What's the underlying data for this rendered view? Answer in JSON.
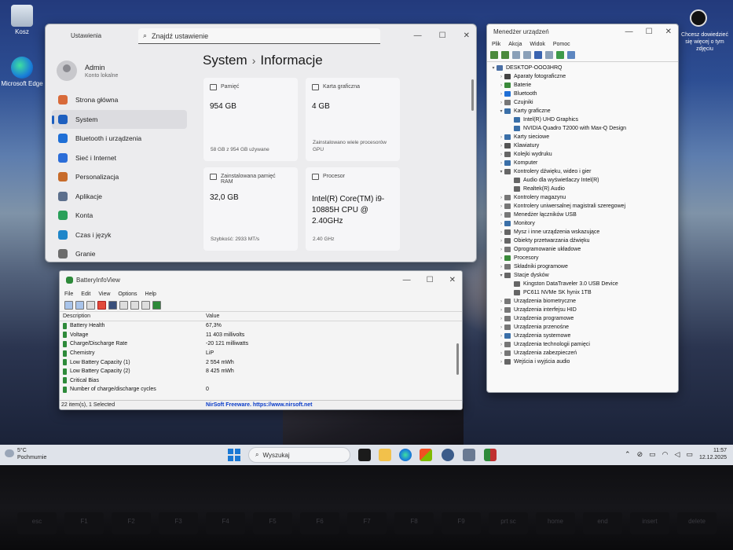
{
  "desktop": {
    "icons": [
      {
        "label": "Kosz",
        "icon": "recycle-bin-icon"
      },
      {
        "label": "Microsoft Edge",
        "icon": "edge-icon"
      }
    ],
    "spotlight_text": "Chcesz dowiedzieć się więcej o tym zdjęciu"
  },
  "settings": {
    "title": "Ustawienia",
    "search_placeholder": "Znajdź ustawienie",
    "user": {
      "name": "Admin",
      "sub": "Konto lokalne"
    },
    "nav": [
      {
        "label": "Strona główna",
        "color": "#d86a3a"
      },
      {
        "label": "System",
        "color": "#1d5fbf"
      },
      {
        "label": "Bluetooth i urządzenia",
        "color": "#1f6fd6"
      },
      {
        "label": "Sieć i Internet",
        "color": "#2b6dd8"
      },
      {
        "label": "Personalizacja",
        "color": "#c76b2a"
      },
      {
        "label": "Aplikacje",
        "color": "#5c6f8c"
      },
      {
        "label": "Konta",
        "color": "#2aa05a"
      },
      {
        "label": "Czas i język",
        "color": "#1f86c9"
      },
      {
        "label": "Granie",
        "color": "#6c6c6c"
      }
    ],
    "breadcrumb_parent": "System",
    "breadcrumb_sep": "›",
    "breadcrumb_current": "Informacje",
    "cards": [
      {
        "label": "Pamięć",
        "value": "954 GB",
        "sub": "58 GB z 954 GB używane"
      },
      {
        "label": "Karta graficzna",
        "value": "4 GB",
        "sub": "Zainstalowano wiele procesorów GPU"
      },
      {
        "label": "Zainstalowana pamięć RAM",
        "value": "32,0 GB",
        "sub": "Szybkość: 2933 MT/s"
      },
      {
        "label": "Procesor",
        "value": "Intel(R) Core(TM) i9-10885H CPU @ 2.40GHz",
        "sub": "2.40 GHz"
      }
    ]
  },
  "devmgr": {
    "title": "Menedżer urządzeń",
    "menu": [
      "Plik",
      "Akcja",
      "Widok",
      "Pomoc"
    ],
    "tree": [
      {
        "label": "DESKTOP-OOO3HRQ",
        "level": 0,
        "arrow": "▾",
        "color": "#4a6fa5"
      },
      {
        "label": "Aparaty fotograficzne",
        "level": 1,
        "arrow": "›",
        "color": "#444"
      },
      {
        "label": "Baterie",
        "level": 1,
        "arrow": "›",
        "color": "#3a8a3a"
      },
      {
        "label": "Bluetooth",
        "level": 1,
        "arrow": "›",
        "color": "#1f6fd6"
      },
      {
        "label": "Czujniki",
        "level": 1,
        "arrow": "›",
        "color": "#777"
      },
      {
        "label": "Karty graficzne",
        "level": 1,
        "arrow": "▾",
        "color": "#3a6fa8"
      },
      {
        "label": "Intel(R) UHD Graphics",
        "level": 2,
        "arrow": "",
        "color": "#3a6fa8"
      },
      {
        "label": "NVIDIA Quadro T2000 with Max-Q Design",
        "level": 2,
        "arrow": "",
        "color": "#3a6fa8"
      },
      {
        "label": "Karty sieciowe",
        "level": 1,
        "arrow": "›",
        "color": "#3a6fa8"
      },
      {
        "label": "Klawiatury",
        "level": 1,
        "arrow": "›",
        "color": "#555"
      },
      {
        "label": "Kolejki wydruku",
        "level": 1,
        "arrow": "›",
        "color": "#666"
      },
      {
        "label": "Komputer",
        "level": 1,
        "arrow": "›",
        "color": "#3a6fa8"
      },
      {
        "label": "Kontrolery dźwięku, wideo i gier",
        "level": 1,
        "arrow": "▾",
        "color": "#666"
      },
      {
        "label": "Audio dla wyświetlaczy Intel(R)",
        "level": 2,
        "arrow": "",
        "color": "#666"
      },
      {
        "label": "Realtek(R) Audio",
        "level": 2,
        "arrow": "",
        "color": "#666"
      },
      {
        "label": "Kontrolery magazynu",
        "level": 1,
        "arrow": "›",
        "color": "#777"
      },
      {
        "label": "Kontrolery uniwersalnej magistrali szeregowej",
        "level": 1,
        "arrow": "›",
        "color": "#777"
      },
      {
        "label": "Menedżer łączników USB",
        "level": 1,
        "arrow": "›",
        "color": "#777"
      },
      {
        "label": "Monitory",
        "level": 1,
        "arrow": "›",
        "color": "#3a6fa8"
      },
      {
        "label": "Mysz i inne urządzenia wskazujące",
        "level": 1,
        "arrow": "›",
        "color": "#666"
      },
      {
        "label": "Obiekty przetwarzania dźwięku",
        "level": 1,
        "arrow": "›",
        "color": "#666"
      },
      {
        "label": "Oprogramowanie układowe",
        "level": 1,
        "arrow": "›",
        "color": "#777"
      },
      {
        "label": "Procesory",
        "level": 1,
        "arrow": "›",
        "color": "#3a8a3a"
      },
      {
        "label": "Składniki programowe",
        "level": 1,
        "arrow": "›",
        "color": "#777"
      },
      {
        "label": "Stacje dysków",
        "level": 1,
        "arrow": "▾",
        "color": "#666"
      },
      {
        "label": "Kingston DataTraveler 3.0 USB Device",
        "level": 2,
        "arrow": "",
        "color": "#666"
      },
      {
        "label": "PC611 NVMe SK hynix 1TB",
        "level": 2,
        "arrow": "",
        "color": "#666"
      },
      {
        "label": "Urządzenia biometryczne",
        "level": 1,
        "arrow": "›",
        "color": "#777"
      },
      {
        "label": "Urządzenia interfejsu HID",
        "level": 1,
        "arrow": "›",
        "color": "#777"
      },
      {
        "label": "Urządzenia programowe",
        "level": 1,
        "arrow": "›",
        "color": "#777"
      },
      {
        "label": "Urządzenia przenośne",
        "level": 1,
        "arrow": "›",
        "color": "#777"
      },
      {
        "label": "Urządzenia systemowe",
        "level": 1,
        "arrow": "›",
        "color": "#3a6fa8"
      },
      {
        "label": "Urządzenia technologii pamięci",
        "level": 1,
        "arrow": "›",
        "color": "#777"
      },
      {
        "label": "Urządzenia zabezpieczeń",
        "level": 1,
        "arrow": "›",
        "color": "#777"
      },
      {
        "label": "Wejścia i wyjścia audio",
        "level": 1,
        "arrow": "›",
        "color": "#666"
      }
    ]
  },
  "battery": {
    "title": "BatteryInfoView",
    "menu": [
      "File",
      "Edit",
      "View",
      "Options",
      "Help"
    ],
    "col_desc": "Description",
    "col_val": "Value",
    "rows": [
      {
        "desc": "Battery Health",
        "val": "67,3%"
      },
      {
        "desc": "Voltage",
        "val": "11 403 millivolts"
      },
      {
        "desc": "Charge/Discharge Rate",
        "val": "-20 121 milliwatts"
      },
      {
        "desc": "Chemistry",
        "val": "LiP"
      },
      {
        "desc": "Low Battery Capacity (1)",
        "val": "2 554 mWh"
      },
      {
        "desc": "Low Battery Capacity (2)",
        "val": "8 425 mWh"
      },
      {
        "desc": "Critical Bias",
        "val": ""
      },
      {
        "desc": "Number of charge/discharge cycles",
        "val": "0"
      }
    ],
    "status_left": "22 item(s), 1 Selected",
    "status_right": "NirSoft Freeware. https://www.nirsoft.net"
  },
  "taskbar": {
    "weather_temp": "5°C",
    "weather_desc": "Pochmurnie",
    "search_placeholder": "Wyszukaj",
    "time": "11:57",
    "date": "12.12.2025"
  },
  "keyboard": [
    "esc",
    "F1",
    "F2",
    "F3",
    "F4",
    "F5",
    "F6",
    "F7",
    "F8",
    "F9",
    "prt sc",
    "home",
    "end",
    "insert",
    "delete"
  ]
}
